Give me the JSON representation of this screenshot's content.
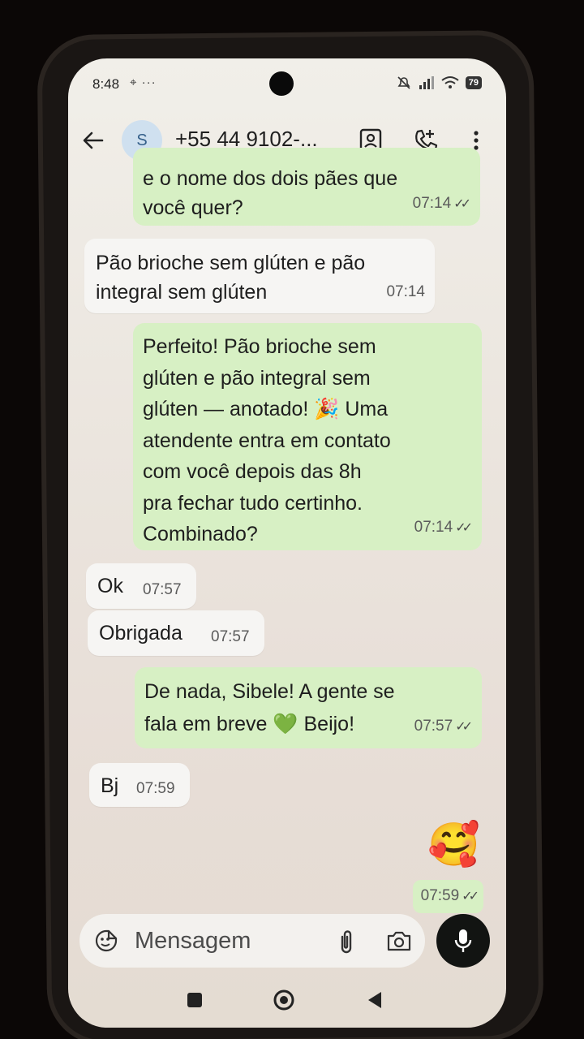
{
  "status_bar": {
    "time": "8:48",
    "extra": "⌖ ···",
    "battery": "79"
  },
  "header": {
    "avatar_letter": "S",
    "contact": "+55 44 9102-..."
  },
  "messages": [
    {
      "lines": [
        "e o nome dos dois pães que",
        "você quer?"
      ],
      "time": "07:14",
      "check": "✓✓"
    },
    {
      "lines": [
        "Pão brioche sem glúten e pão",
        "integral sem glúten"
      ],
      "time": "07:14"
    },
    {
      "lines": [
        "Perfeito! Pão brioche sem",
        "glúten e pão integral sem",
        "glúten — anotado! 🎉 Uma",
        "atendente entra em contato",
        "com você depois das 8h",
        "pra fechar tudo certinho.",
        "Combinado?"
      ],
      "time": "07:14",
      "check": "✓✓"
    },
    {
      "text": "Ok",
      "time": "07:57"
    },
    {
      "text": "Obrigada",
      "time": "07:57"
    },
    {
      "lines": [
        "De nada, Sibele! A gente se",
        "fala em breve 💚 Beijo!"
      ],
      "time": "07:57",
      "check": "✓✓"
    },
    {
      "text": "Bj",
      "time": "07:59"
    },
    {
      "emoji": "🥰",
      "time": "07:59",
      "check": "✓✓"
    }
  ],
  "composer": {
    "placeholder": "Mensagem"
  },
  "colors": {
    "outgoing": "#d7f0c4",
    "incoming": "#f6f5f3",
    "mic": "#121412"
  }
}
